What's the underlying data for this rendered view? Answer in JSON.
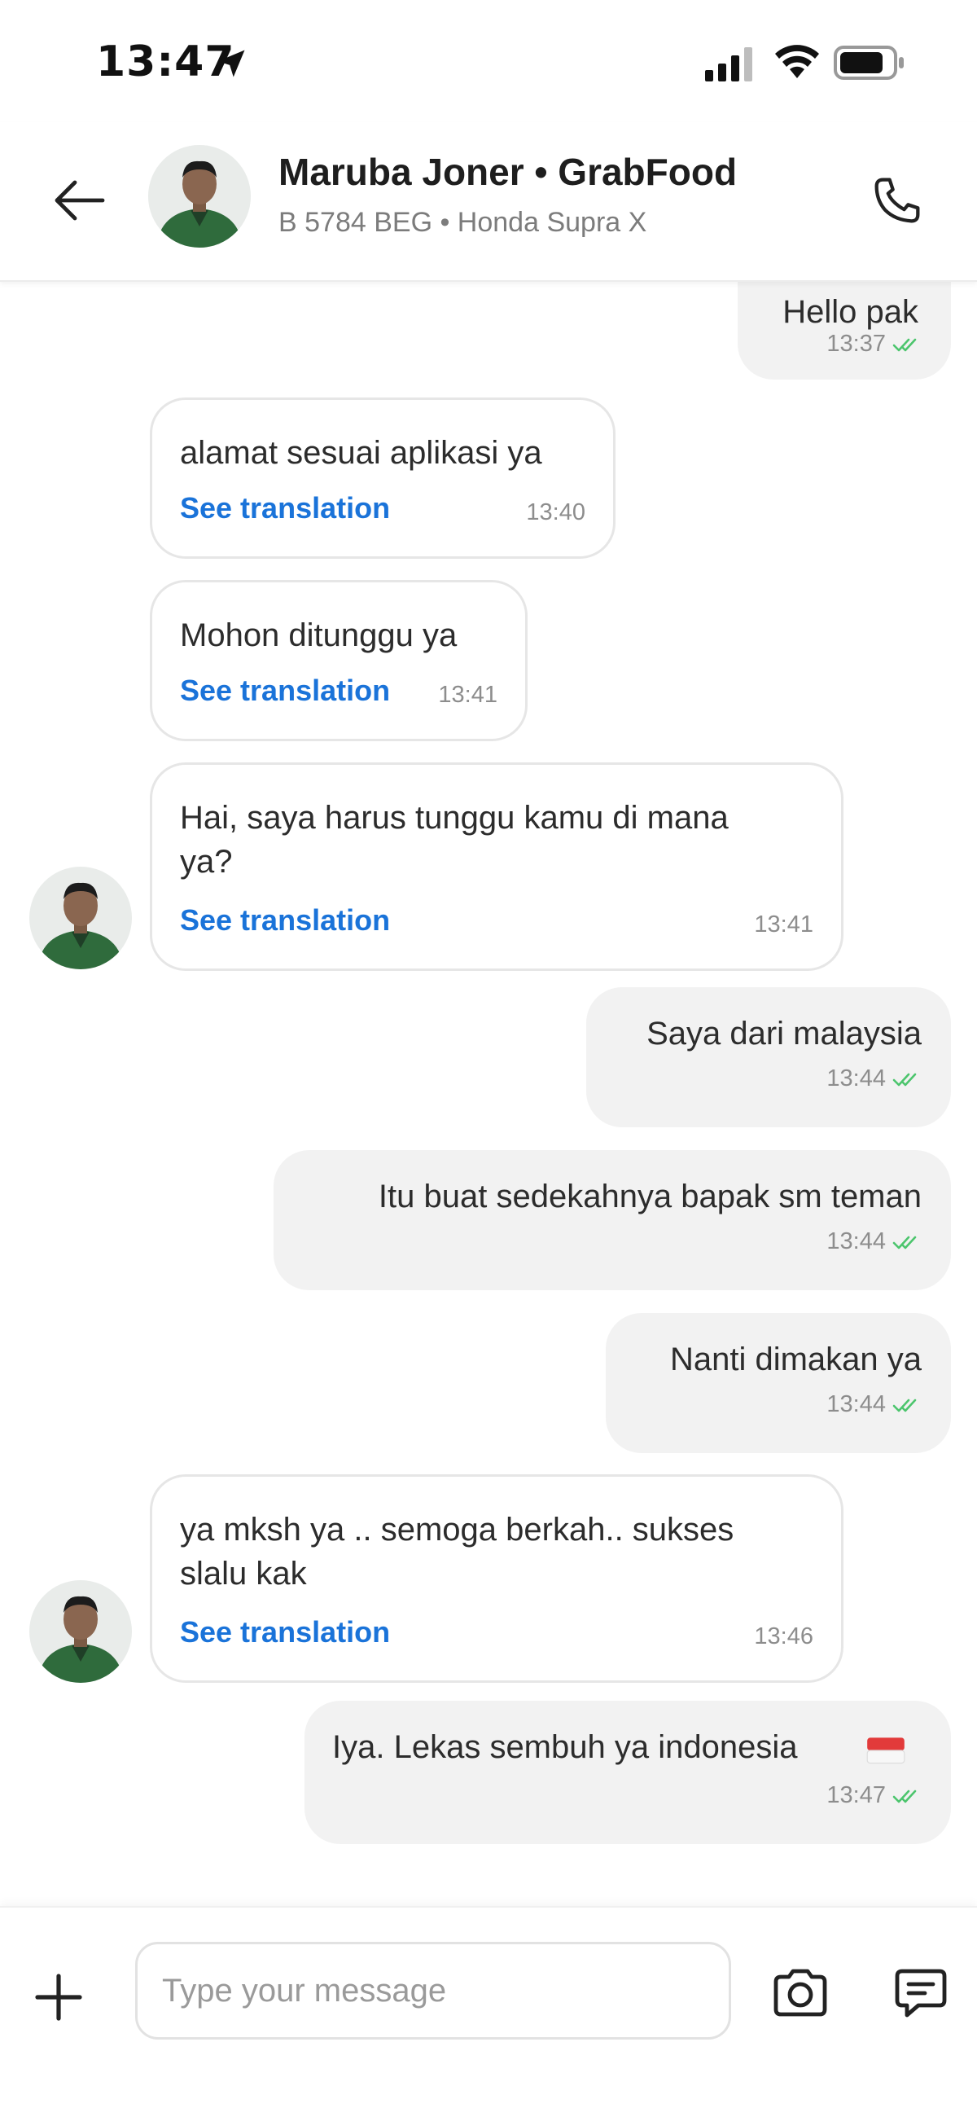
{
  "status_bar": {
    "time": "13:47"
  },
  "header": {
    "title": "Maruba Joner • GrabFood",
    "subtitle": "B 5784 BEG • Honda Supra X"
  },
  "messages": [
    {
      "direction": "out",
      "text": "Hello pak",
      "time": "13:37"
    },
    {
      "direction": "in",
      "text": "alamat sesuai aplikasi ya",
      "translate": "See translation",
      "time": "13:40"
    },
    {
      "direction": "in",
      "text": "Mohon ditunggu ya",
      "translate": "See translation",
      "time": "13:41"
    },
    {
      "direction": "in",
      "text_line1": "Hai, saya harus tunggu kamu di mana",
      "text_line2": "ya?",
      "translate": "See translation",
      "time": "13:41"
    },
    {
      "direction": "out",
      "text": "Saya dari malaysia",
      "time": "13:44"
    },
    {
      "direction": "out",
      "text": "Itu buat sedekahnya bapak sm teman",
      "time": "13:44"
    },
    {
      "direction": "out",
      "text": "Nanti dimakan ya",
      "time": "13:44"
    },
    {
      "direction": "in",
      "text_line1": "ya mksh ya .. semoga berkah.. sukses",
      "text_line2": "slalu kak",
      "translate": "See translation",
      "time": "13:46"
    },
    {
      "direction": "out",
      "text": "Iya. Lekas sembuh ya indonesia",
      "time": "13:47"
    }
  ],
  "composer": {
    "placeholder": "Type your message"
  },
  "colors": {
    "link": "#1a73d9",
    "read_tick": "#4cc56d",
    "driver_jacket": "#2f6b3c"
  },
  "icons": {
    "back": "arrow-left",
    "call": "phone",
    "add": "plus",
    "camera": "camera",
    "quick_reply": "chat-bubble-lines",
    "read_receipt": "double-check",
    "flag": "indonesia-flag"
  }
}
